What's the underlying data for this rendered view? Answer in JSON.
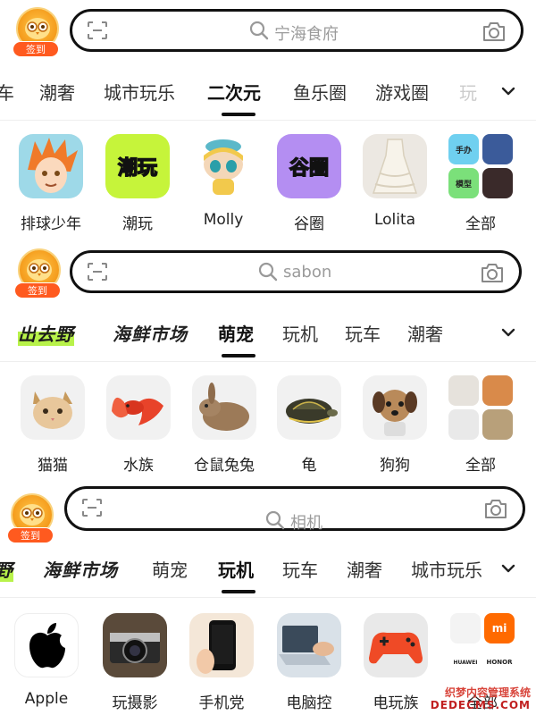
{
  "colors": {
    "accent": "#ff5a1f",
    "badge_gold": "#f49a1a",
    "active_tab": "#111111"
  },
  "panels": [
    {
      "signin_label": "签到",
      "search_placeholder": "宁海食府",
      "tabs": [
        "车",
        "潮奢",
        "城市玩乐",
        "二次元",
        "鱼乐圈",
        "游戏圈",
        "玩"
      ],
      "active_tab": "二次元",
      "categories": [
        "排球少年",
        "潮玩",
        "Molly",
        "谷圈",
        "Lolita",
        "全部"
      ],
      "thumb_texts": {
        "chaowan": "潮玩",
        "guquan": "谷圈",
        "shouban": "手办",
        "moxing": "模型"
      }
    },
    {
      "signin_label": "签到",
      "search_placeholder": "sabon",
      "tabs": [
        "出去野",
        "海鲜市场",
        "萌宠",
        "玩机",
        "玩车",
        "潮奢"
      ],
      "active_tab": "萌宠",
      "categories": [
        "猫猫",
        "水族",
        "仓鼠兔兔",
        "龟",
        "狗狗",
        "全部"
      ]
    },
    {
      "signin_label": "签到",
      "search_placeholder": "相机",
      "tabs": [
        "野",
        "海鲜市场",
        "萌宠",
        "玩机",
        "玩车",
        "潮奢",
        "城市玩乐"
      ],
      "active_tab": "玩机",
      "categories": [
        "Apple",
        "玩摄影",
        "手机党",
        "电脑控",
        "电玩族",
        "全部"
      ],
      "thumb_texts": {
        "huawei": "HUAWEI",
        "honor": "HONOR",
        "mi": "mi"
      }
    }
  ],
  "icons": [
    "scan-icon",
    "search-icon",
    "camera-icon",
    "chevron-down-icon",
    "owl-mascot-icon"
  ],
  "watermark": {
    "line1": "织梦内容管理系统",
    "line2": "DEDECMS.COM"
  }
}
